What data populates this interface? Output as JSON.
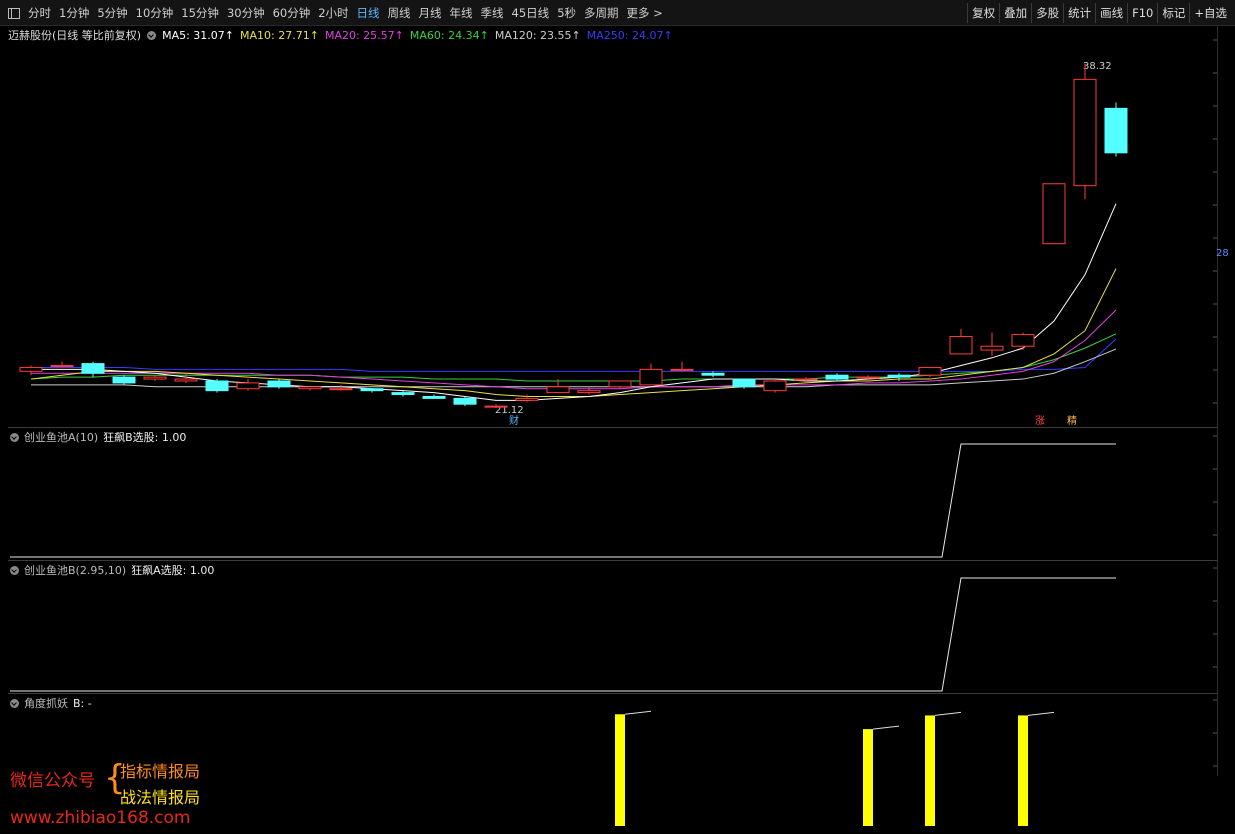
{
  "toolbar": {
    "periods": [
      "分时",
      "1分钟",
      "5分钟",
      "10分钟",
      "15分钟",
      "30分钟",
      "60分钟",
      "2小时",
      "日线",
      "周线",
      "月线",
      "年线",
      "季线",
      "45日线",
      "5秒",
      "多周期",
      "更多 >"
    ],
    "active": "日线",
    "right_buttons": [
      "复权",
      "叠加",
      "多股",
      "统计",
      "画线",
      "F10",
      "标记",
      "+自选"
    ]
  },
  "info": {
    "stock": "迈赫股份(日线 等比前复权)",
    "ma": [
      {
        "label": "MA5: 31.07↑",
        "color": "#ffffff"
      },
      {
        "label": "MA10: 27.71↑",
        "color": "#e8e04a"
      },
      {
        "label": "MA20: 25.57↑",
        "color": "#e040e0"
      },
      {
        "label": "MA60: 24.34↑",
        "color": "#3ad03a"
      },
      {
        "label": "MA120: 23.55↑",
        "color": "#cccccc"
      },
      {
        "label": "MA250: 24.07↑",
        "color": "#3a3aff"
      }
    ]
  },
  "price_labels": {
    "high": "38.32",
    "low": "21.12",
    "axis_mark": "28"
  },
  "tags": {
    "cai": "财",
    "zhang": "涨",
    "jing": "精"
  },
  "panes": {
    "a_title": "创业鱼池A(10)",
    "a_value": "狂飙B选股: 1.00",
    "b_title": "创业鱼池B(2.95,10)",
    "b_value": "狂飙A选股: 1.00",
    "c_title": "角度抓妖",
    "c_value": "B: -"
  },
  "watermark": {
    "line1": "微信公众号",
    "line2": "指标情报局",
    "line3": "战法情报局",
    "url": "www.zhibiao168.com"
  },
  "colors": {
    "up": "#ff3a3a",
    "down": "#54ffff",
    "active": "#5ab7ff",
    "bar": "#ffff00"
  },
  "candles": [
    {
      "o": 22.4,
      "c": 22.6,
      "h": 22.7,
      "l": 22.2
    },
    {
      "o": 22.7,
      "c": 22.7,
      "h": 22.9,
      "l": 22.6
    },
    {
      "o": 22.8,
      "c": 22.3,
      "h": 22.9,
      "l": 22.1
    },
    {
      "o": 22.1,
      "c": 21.8,
      "h": 22.2,
      "l": 21.7
    },
    {
      "o": 22.0,
      "c": 22.1,
      "h": 22.2,
      "l": 21.9
    },
    {
      "o": 21.9,
      "c": 22.0,
      "h": 22.3,
      "l": 21.8
    },
    {
      "o": 21.9,
      "c": 21.4,
      "h": 22.0,
      "l": 21.3
    },
    {
      "o": 21.5,
      "c": 21.8,
      "h": 22.0,
      "l": 21.4
    },
    {
      "o": 21.9,
      "c": 21.6,
      "h": 22.0,
      "l": 21.5
    },
    {
      "o": 21.5,
      "c": 21.6,
      "h": 21.6,
      "l": 21.4
    },
    {
      "o": 21.5,
      "c": 21.5,
      "h": 21.7,
      "l": 21.4
    },
    {
      "o": 21.5,
      "c": 21.4,
      "h": 21.5,
      "l": 21.3
    },
    {
      "o": 21.3,
      "c": 21.2,
      "h": 21.4,
      "l": 21.1
    },
    {
      "o": 21.1,
      "c": 21.0,
      "h": 21.2,
      "l": 21.0
    },
    {
      "o": 21.0,
      "c": 20.7,
      "h": 21.1,
      "l": 20.6
    },
    {
      "o": 20.6,
      "c": 20.6,
      "h": 20.7,
      "l": 20.5
    },
    {
      "o": 20.9,
      "c": 21.0,
      "h": 21.2,
      "l": 20.8
    },
    {
      "o": 21.3,
      "c": 21.6,
      "h": 22.0,
      "l": 21.3
    },
    {
      "o": 21.3,
      "c": 21.4,
      "h": 21.6,
      "l": 21.2
    },
    {
      "o": 21.6,
      "c": 21.9,
      "h": 21.9,
      "l": 21.5
    },
    {
      "o": 21.7,
      "c": 22.5,
      "h": 22.8,
      "l": 21.7
    },
    {
      "o": 22.5,
      "c": 22.5,
      "h": 22.9,
      "l": 22.4
    },
    {
      "o": 22.3,
      "c": 22.2,
      "h": 22.4,
      "l": 22.1
    },
    {
      "o": 22.0,
      "c": 21.6,
      "h": 22.0,
      "l": 21.5
    },
    {
      "o": 21.4,
      "c": 21.9,
      "h": 22.0,
      "l": 21.3
    },
    {
      "o": 22.0,
      "c": 22.0,
      "h": 22.1,
      "l": 21.9
    },
    {
      "o": 22.2,
      "c": 22.0,
      "h": 22.3,
      "l": 21.9
    },
    {
      "o": 22.1,
      "c": 22.1,
      "h": 22.2,
      "l": 22.0
    },
    {
      "o": 22.2,
      "c": 22.1,
      "h": 22.3,
      "l": 21.9
    },
    {
      "o": 22.2,
      "c": 22.6,
      "h": 22.6,
      "l": 22.1
    },
    {
      "o": 23.3,
      "c": 24.2,
      "h": 24.6,
      "l": 23.3
    },
    {
      "o": 23.5,
      "c": 23.7,
      "h": 24.4,
      "l": 23.2
    },
    {
      "o": 23.7,
      "c": 24.3,
      "h": 24.4,
      "l": 23.5
    },
    {
      "o": 29.0,
      "c": 32.1,
      "h": 32.1,
      "l": 29.0
    },
    {
      "o": 32.0,
      "c": 37.5,
      "h": 38.32,
      "l": 31.3
    },
    {
      "o": 36.0,
      "c": 33.7,
      "h": 36.3,
      "l": 33.5
    }
  ],
  "ma_series": {
    "ma5": [
      22.5,
      22.5,
      22.5,
      22.4,
      22.3,
      22.1,
      21.9,
      21.8,
      21.7,
      21.6,
      21.6,
      21.5,
      21.4,
      21.3,
      21.1,
      20.9,
      20.9,
      21.0,
      21.1,
      21.3,
      21.6,
      21.8,
      22.0,
      22.0,
      22.0,
      21.9,
      21.9,
      22.0,
      22.1,
      22.3,
      22.7,
      23.1,
      23.6,
      25.0,
      27.4,
      31.07
    ],
    "ma10": [
      22.0,
      22.2,
      22.4,
      22.4,
      22.4,
      22.3,
      22.2,
      22.1,
      22.0,
      21.9,
      21.8,
      21.7,
      21.6,
      21.5,
      21.4,
      21.2,
      21.1,
      21.1,
      21.1,
      21.2,
      21.3,
      21.4,
      21.5,
      21.6,
      21.7,
      21.8,
      21.9,
      21.9,
      22.0,
      22.0,
      22.2,
      22.4,
      22.6,
      23.3,
      24.5,
      27.71
    ],
    "ma20": [
      22.3,
      22.3,
      22.3,
      22.3,
      22.3,
      22.3,
      22.3,
      22.3,
      22.2,
      22.2,
      22.1,
      22.0,
      21.9,
      21.8,
      21.7,
      21.6,
      21.5,
      21.5,
      21.5,
      21.5,
      21.6,
      21.6,
      21.6,
      21.7,
      21.7,
      21.7,
      21.7,
      21.8,
      21.8,
      21.9,
      22.0,
      22.2,
      22.4,
      22.9,
      24.0,
      25.57
    ],
    "ma60": [
      22.0,
      22.1,
      22.1,
      22.2,
      22.2,
      22.2,
      22.2,
      22.2,
      22.2,
      22.2,
      22.1,
      22.1,
      22.1,
      22.0,
      22.0,
      22.0,
      21.9,
      21.9,
      21.9,
      21.9,
      21.9,
      22.0,
      22.0,
      22.0,
      22.0,
      22.0,
      22.1,
      22.1,
      22.1,
      22.2,
      22.3,
      22.4,
      22.6,
      23.0,
      23.6,
      24.34
    ],
    "ma120": [
      21.7,
      21.7,
      21.7,
      21.7,
      21.6,
      21.6,
      21.6,
      21.6,
      21.6,
      21.6,
      21.6,
      21.6,
      21.6,
      21.6,
      21.6,
      21.6,
      21.6,
      21.6,
      21.6,
      21.6,
      21.6,
      21.6,
      21.6,
      21.6,
      21.6,
      21.6,
      21.7,
      21.7,
      21.7,
      21.7,
      21.8,
      21.9,
      22.0,
      22.3,
      22.9,
      23.55
    ],
    "ma250": [
      22.6,
      22.6,
      22.6,
      22.6,
      22.5,
      22.5,
      22.5,
      22.5,
      22.5,
      22.5,
      22.5,
      22.4,
      22.4,
      22.4,
      22.4,
      22.4,
      22.4,
      22.4,
      22.4,
      22.4,
      22.4,
      22.4,
      22.4,
      22.4,
      22.4,
      22.4,
      22.4,
      22.4,
      22.4,
      22.4,
      22.4,
      22.4,
      22.5,
      22.5,
      22.6,
      24.07
    ]
  },
  "signal_a": [
    0,
    0,
    0,
    0,
    0,
    0,
    0,
    0,
    0,
    0,
    0,
    0,
    0,
    0,
    0,
    0,
    0,
    0,
    0,
    0,
    0,
    0,
    0,
    0,
    0,
    0,
    0,
    0,
    0,
    0,
    1,
    1,
    1,
    1,
    1,
    1
  ],
  "signal_b": [
    0,
    0,
    0,
    0,
    0,
    0,
    0,
    0,
    0,
    0,
    0,
    0,
    0,
    0,
    0,
    0,
    0,
    0,
    0,
    0,
    0,
    0,
    0,
    0,
    0,
    0,
    0,
    0,
    0,
    0,
    1,
    1,
    1,
    1,
    1,
    1
  ],
  "angle_bars": [
    {
      "i": 19,
      "v": 0.98
    },
    {
      "i": 27,
      "v": 0.85
    },
    {
      "i": 29,
      "v": 0.97
    },
    {
      "i": 32,
      "v": 0.97
    }
  ]
}
